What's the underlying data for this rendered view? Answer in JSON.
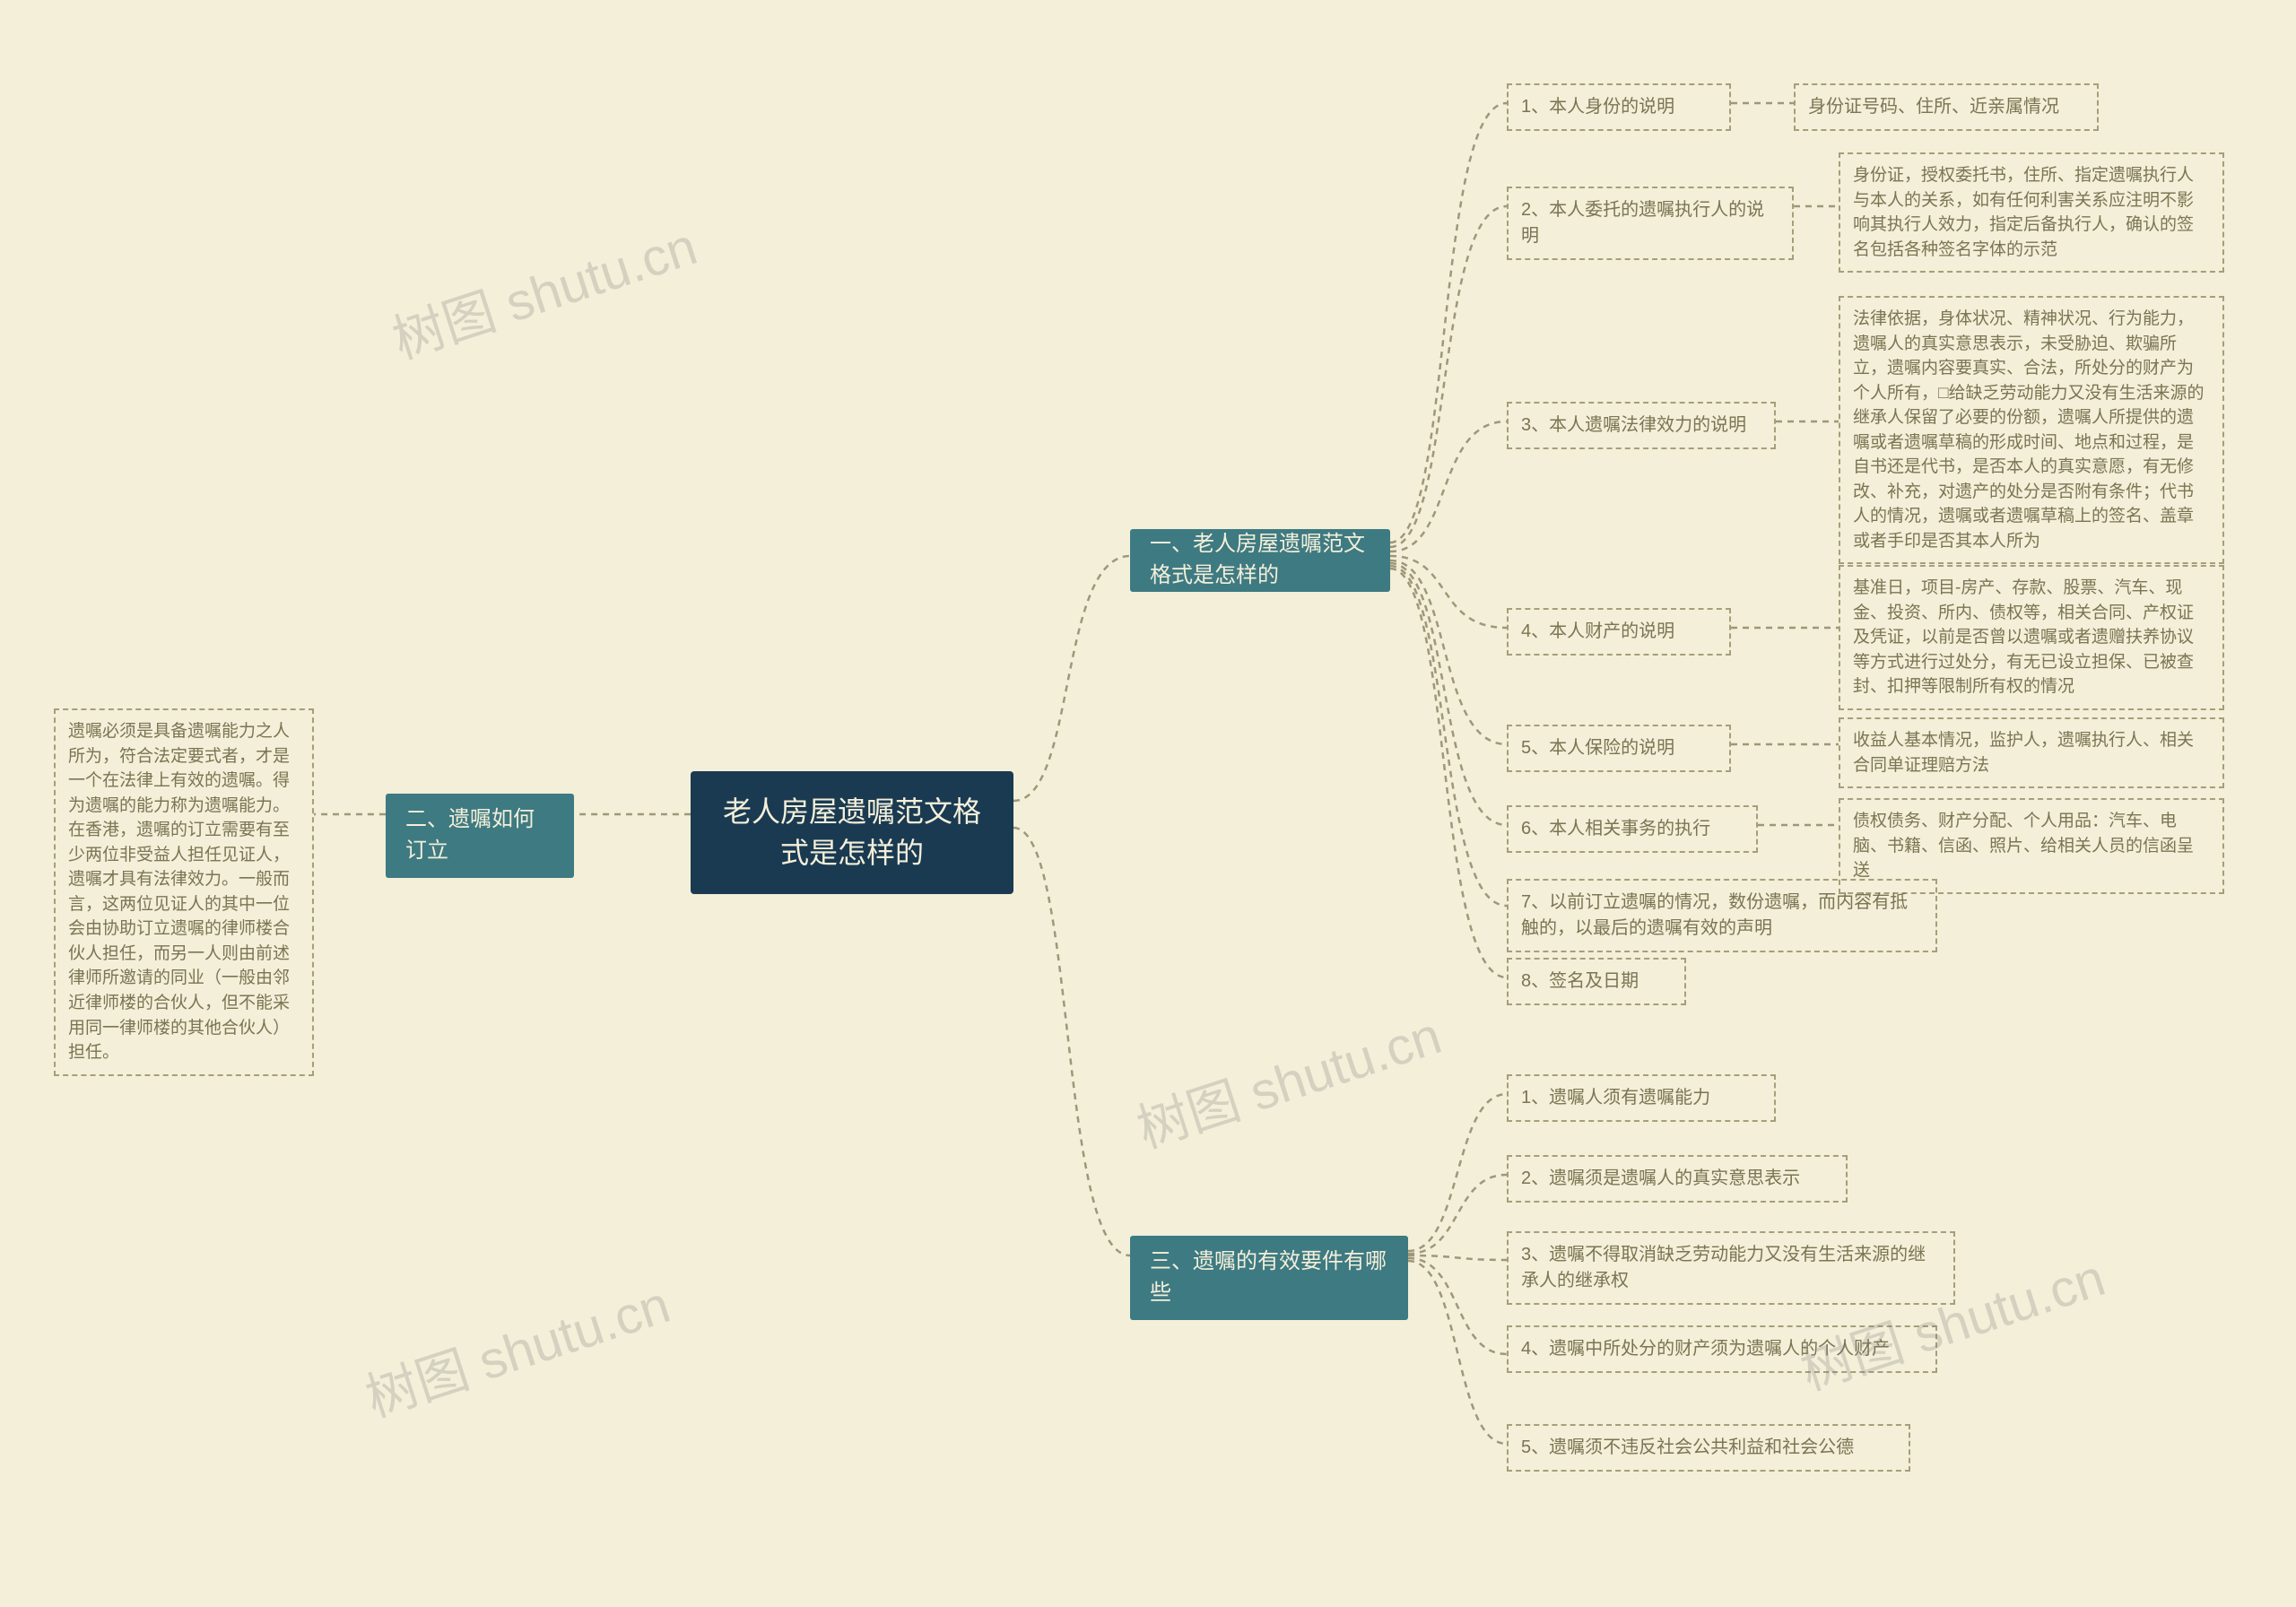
{
  "root": {
    "title": "老人房屋遗嘱范文格式是怎样的"
  },
  "branches": {
    "b1": {
      "label": "一、老人房屋遗嘱范文格式是怎样的"
    },
    "b2": {
      "label": "二、遗嘱如何订立"
    },
    "b3": {
      "label": "三、遗嘱的有效要件有哪些"
    }
  },
  "section1": {
    "n1": {
      "label": "1、本人身份的说明",
      "detail": "身份证号码、住所、近亲属情况"
    },
    "n2": {
      "label": "2、本人委托的遗嘱执行人的说明",
      "detail": "身份证，授权委托书，住所、指定遗嘱执行人与本人的关系，如有任何利害关系应注明不影响其执行人效力，指定后备执行人，确认的签名包括各种签名字体的示范"
    },
    "n3": {
      "label": "3、本人遗嘱法律效力的说明",
      "detail": "法律依据，身体状况、精神状况、行为能力，遗嘱人的真实意思表示，未受胁迫、欺骗所立，遗嘱内容要真实、合法，所处分的财产为个人所有，□给缺乏劳动能力又没有生活来源的继承人保留了必要的份额，遗嘱人所提供的遗嘱或者遗嘱草稿的形成时间、地点和过程，是自书还是代书，是否本人的真实意愿，有无修改、补充，对遗产的处分是否附有条件；代书人的情况，遗嘱或者遗嘱草稿上的签名、盖章或者手印是否其本人所为"
    },
    "n4": {
      "label": "4、本人财产的说明",
      "detail": "基准日，项目-房产、存款、股票、汽车、现金、投资、所内、债权等，相关合同、产权证及凭证，以前是否曾以遗嘱或者遗赠扶养协议等方式进行过处分，有无已设立担保、已被查封、扣押等限制所有权的情况"
    },
    "n5": {
      "label": "5、本人保险的说明",
      "detail": "收益人基本情况，监护人，遗嘱执行人、相关合同单证理赔方法"
    },
    "n6": {
      "label": "6、本人相关事务的执行",
      "detail": "债权债务、财产分配、个人用品：汽车、电脑、书籍、信函、照片、给相关人员的信函呈送"
    },
    "n7": {
      "label": "7、以前订立遗嘱的情况，数份遗嘱，而内容有抵触的，以最后的遗嘱有效的声明"
    },
    "n8": {
      "label": "8、签名及日期"
    }
  },
  "section2": {
    "detail": "遗嘱必须是具备遗嘱能力之人所为，符合法定要式者，才是一个在法律上有效的遗嘱。得为遗嘱的能力称为遗嘱能力。在香港，遗嘱的订立需要有至少两位非受益人担任见证人，遗嘱才具有法律效力。一般而言，这两位见证人的其中一位会由协助订立遗嘱的律师楼合伙人担任，而另一人则由前述律师所邀请的同业（一般由邻近律师楼的合伙人，但不能采用同一律师楼的其他合伙人）担任。"
  },
  "section3": {
    "n1": "1、遗嘱人须有遗嘱能力",
    "n2": "2、遗嘱须是遗嘱人的真实意思表示",
    "n3": "3、遗嘱不得取消缺乏劳动能力又没有生活来源的继承人的继承权",
    "n4": "4、遗嘱中所处分的财产须为遗嘱人的个人财产",
    "n5": "5、遗嘱须不违反社会公共利益和社会公德"
  },
  "watermark": "树图 shutu.cn"
}
